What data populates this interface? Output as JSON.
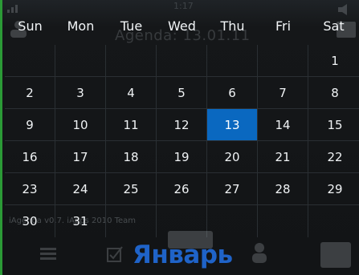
{
  "background": {
    "time": "1:17",
    "agenda_title": "Agenda: 13.01.11",
    "footer_text": "iAgenda v0.7.  iApps 2010 Team",
    "month_label": "Январь"
  },
  "calendar": {
    "weekdays": [
      "Sun",
      "Mon",
      "Tue",
      "Wed",
      "Thu",
      "Fri",
      "Sat"
    ],
    "weeks": [
      [
        "",
        "",
        "",
        "",
        "",
        "",
        "1"
      ],
      [
        "2",
        "3",
        "4",
        "5",
        "6",
        "7",
        "8"
      ],
      [
        "9",
        "10",
        "11",
        "12",
        "13",
        "14",
        "15"
      ],
      [
        "16",
        "17",
        "18",
        "19",
        "20",
        "21",
        "22"
      ],
      [
        "23",
        "24",
        "25",
        "26",
        "27",
        "28",
        "29"
      ],
      [
        "30",
        "31",
        "",
        "",
        "",
        "",
        ""
      ]
    ],
    "selected_day": "13"
  },
  "colors": {
    "selected_bg": "#0a68c0",
    "month_accent": "#1f63c8",
    "left_edge": "#2b9a36"
  },
  "icons": [
    "signal-icon",
    "volume-icon",
    "person-icon",
    "list-icon",
    "calendar-icon",
    "checkbox-icon",
    "person-silhouette-icon",
    "grid-icon"
  ]
}
